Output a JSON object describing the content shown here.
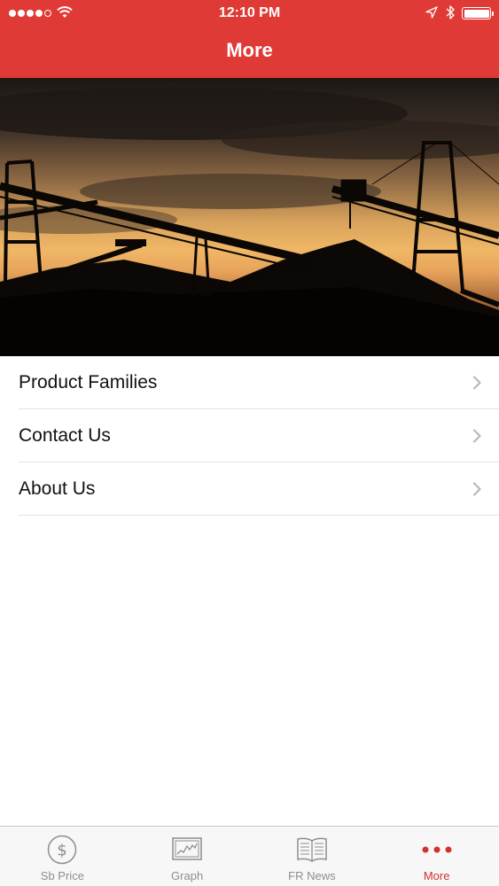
{
  "status_bar": {
    "time": "12:10 PM",
    "signal_icon": "cellular-signal-icon",
    "wifi_icon": "wifi-icon",
    "location_icon": "location-arrow-icon",
    "bluetooth_icon": "bluetooth-icon",
    "battery_icon": "battery-full-icon",
    "battery_level": 1.0,
    "signal_bars": 4
  },
  "nav": {
    "title": "More"
  },
  "hero": {
    "image": "industrial conveyor belts silhouetted against sunset sky"
  },
  "menu": {
    "items": [
      {
        "label": "Product Families"
      },
      {
        "label": "Contact Us"
      },
      {
        "label": "About Us"
      }
    ],
    "chevron_icon": "chevron-right-icon"
  },
  "tabbar": {
    "tabs": [
      {
        "label": "Sb Price",
        "icon": "dollar-circle-icon",
        "active": false
      },
      {
        "label": "Graph",
        "icon": "line-graph-icon",
        "active": false
      },
      {
        "label": "FR News",
        "icon": "open-book-icon",
        "active": false
      },
      {
        "label": "More",
        "icon": "more-dots-icon",
        "active": true
      }
    ]
  },
  "colors": {
    "brand_red": "#e03a36",
    "active_tab": "#d0322c",
    "inactive_tab": "#8e8e8e"
  }
}
